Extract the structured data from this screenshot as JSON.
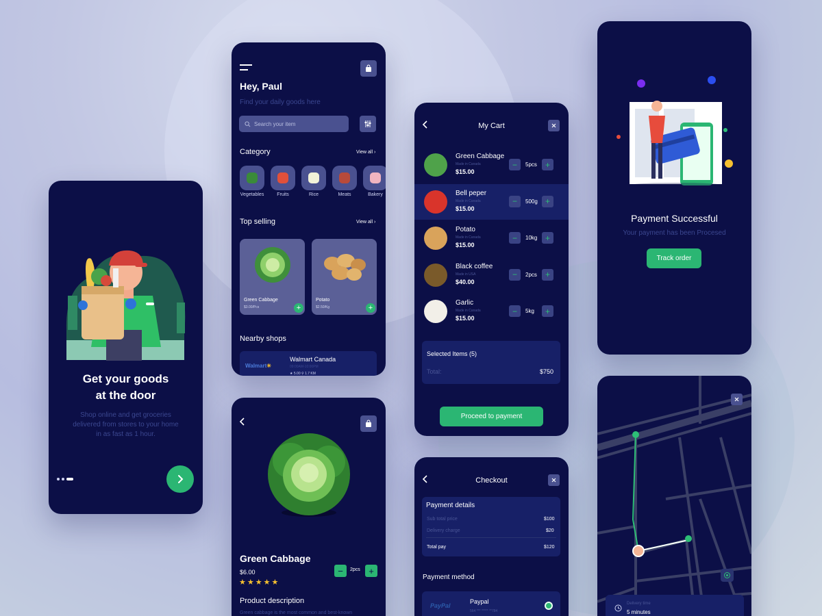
{
  "colors": {
    "background": "#c2c7e3",
    "phone": "#0c0f47",
    "accent_green": "#2bb673",
    "panel": "#172067",
    "muted_text": "#3b4790"
  },
  "onboarding": {
    "title_line1": "Get your goods",
    "title_line2": "at the door",
    "desc_line1": "Shop online and get groceries",
    "desc_line2": "delivered from stores to your home",
    "desc_line3": "in as fast as 1 hour.",
    "next_icon": "chevron-right-icon"
  },
  "home": {
    "greeting": "Hey, Paul",
    "subtitle": "Find your daily goods here",
    "search_placeholder": "Search your item",
    "category_title": "Category",
    "view_all": "View all",
    "categories": [
      {
        "label": "Vegetables",
        "color": "#3a8a3a"
      },
      {
        "label": "Fruits",
        "color": "#e0503a"
      },
      {
        "label": "Rice",
        "color": "#f2f2d8"
      },
      {
        "label": "Meats",
        "color": "#b84a3a"
      },
      {
        "label": "Bakery",
        "color": "#f1b5c0"
      }
    ],
    "top_selling_title": "Top selling",
    "products": [
      {
        "name": "Green Cabbage",
        "price": "$3.00/Pcs"
      },
      {
        "name": "Potato",
        "price": "$2.50/Kg"
      }
    ],
    "nearby_title": "Nearby shops",
    "shop": {
      "logo": "Walmart",
      "name": "Walmart Canada",
      "hours": "09:00AM-10:00PM",
      "rating": "5.00",
      "distance": "1.7 KM"
    }
  },
  "detail": {
    "name": "Green Cabbage",
    "price": "$6.00",
    "qty": "2pcs",
    "stars": "★★★★★",
    "desc_title": "Product description",
    "desc_text": "Green cabbage is the most common and best-known"
  },
  "cart": {
    "title": "My Cart",
    "items": [
      {
        "name": "Green Cabbage",
        "origin": "Made in Canada",
        "price": "$15.00",
        "qty": "5pcs"
      },
      {
        "name": "Bell peper",
        "origin": "Made in Canada",
        "price": "$15.00",
        "qty": "500g"
      },
      {
        "name": "Potato",
        "origin": "Made in Canada",
        "price": "$15.00",
        "qty": "10kg"
      },
      {
        "name": "Black coffee",
        "origin": "Made in USA",
        "price": "$40.00",
        "qty": "2pcs"
      },
      {
        "name": "Garlic",
        "origin": "Made in Canada",
        "price": "$15.00",
        "qty": "5kg"
      }
    ],
    "selected": "Selected Items (5)",
    "total_label": "Total:",
    "total_value": "$750",
    "proceed": "Proceed to payment"
  },
  "checkout": {
    "title": "Checkout",
    "details_title": "Payment details",
    "subtotal_label": "Sub total price",
    "subtotal_value": "$100",
    "delivery_label": "Delivery charge",
    "delivery_value": "$20",
    "total_label": "Total pay",
    "total_value": "$120",
    "method_title": "Payment method",
    "paypal_logo": "PayPal",
    "paypal_name": "Paypal",
    "paypal_number": "564 *** ***** **784"
  },
  "success": {
    "title": "Payment Successful",
    "subtitle": "Your payment has been Procesed",
    "track": "Track order"
  },
  "map": {
    "delivery_label": "Delivery time",
    "delivery_value": "5 minutes"
  }
}
